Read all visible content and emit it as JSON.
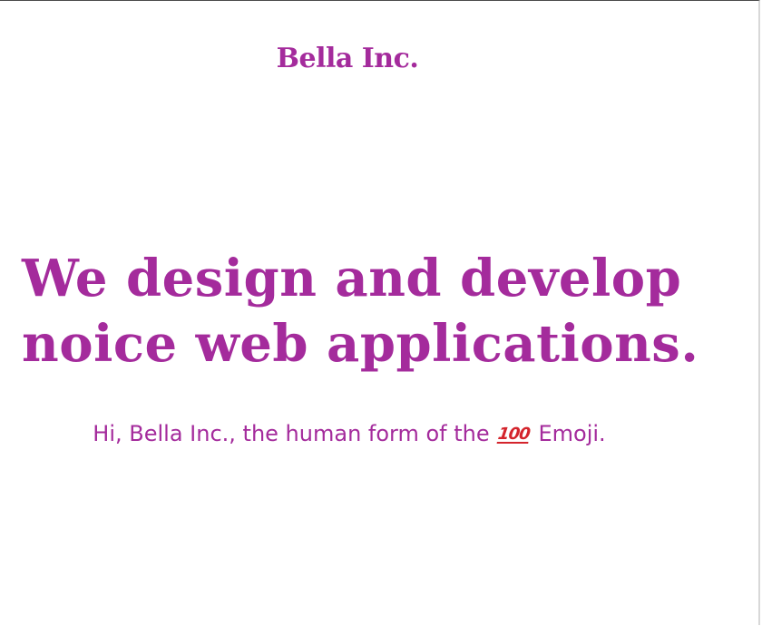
{
  "header": {
    "brand": "Bella Inc."
  },
  "hero": {
    "headline_line1": "We design and develop",
    "headline_line2": "noice web applications.",
    "tagline_before": "Hi, Bella Inc., the human form of the ",
    "tagline_emoji": "100",
    "tagline_after": " Emoji."
  },
  "colors": {
    "accent": "#a42b9c",
    "background": "#ffffff",
    "emoji": "#d4242c"
  },
  "icons": {
    "tagline_emoji": "hundred-points-icon"
  }
}
